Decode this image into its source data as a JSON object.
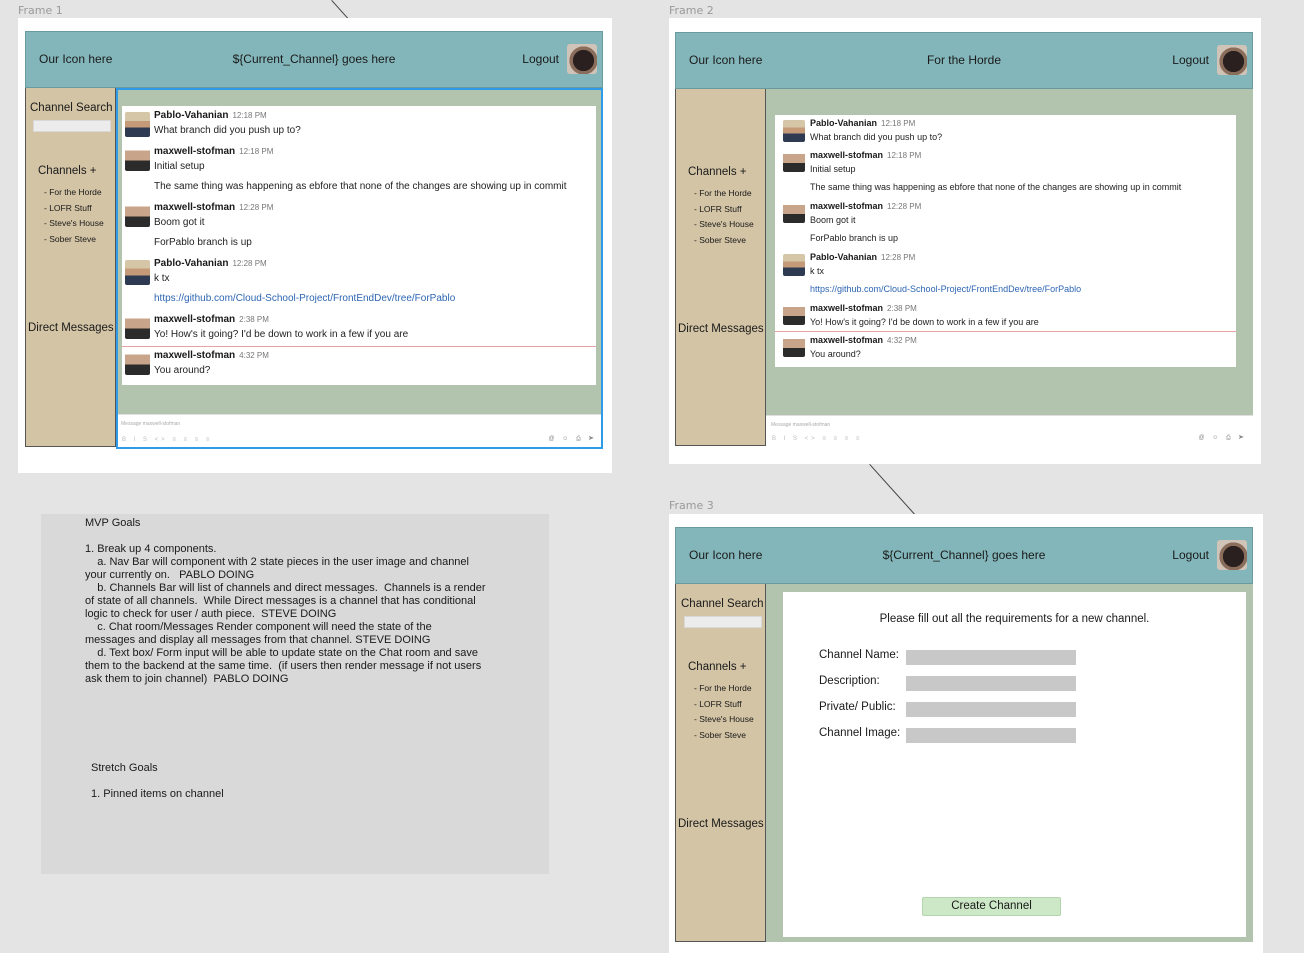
{
  "frames": {
    "frame1": "Frame 1",
    "frame2": "Frame 2",
    "frame3": "Frame 3"
  },
  "header": {
    "icon_text": "Our Icon here",
    "channel_placeholder": "${Current_Channel} goes here",
    "channel_active": "For the Horde",
    "logout": "Logout"
  },
  "sidebar": {
    "channel_search": "Channel Search",
    "channels_label": "Channels +",
    "channels": [
      "- For the Horde",
      "- LOFR Stuff",
      "- Steve's House",
      "- Sober Steve"
    ],
    "direct_messages": "Direct Messages"
  },
  "messages": [
    {
      "user": "Pablo-Vahanian",
      "time": "12:18 PM",
      "text": "What branch did you push up to?",
      "avatar": "pablo"
    },
    {
      "user": "maxwell-stofman",
      "time": "12:18 PM",
      "text": "Initial setup",
      "avatar": "max"
    },
    {
      "text": "The same thing was happening as ebfore that none of the changes are showing up in commit"
    },
    {
      "user": "maxwell-stofman",
      "time": "12:28 PM",
      "text": "Boom got it",
      "avatar": "max"
    },
    {
      "text": "ForPablo branch is up"
    },
    {
      "user": "Pablo-Vahanian",
      "time": "12:28 PM",
      "text": "k tx",
      "avatar": "pablo"
    },
    {
      "text": "https://github.com/Cloud-School-Project/FrontEndDev/tree/ForPablo",
      "link": true
    },
    {
      "user": "maxwell-stofman",
      "time": "2:38 PM",
      "text": "Yo! How's it going? I'd be down to work in a few if you are",
      "avatar": "max"
    },
    {
      "user": "maxwell-stofman",
      "time": "4:32 PM",
      "text": "You around?",
      "avatar": "max"
    }
  ],
  "composer": {
    "placeholder": "Message maxwell-stofman"
  },
  "notes": {
    "mvp_title": "MVP Goals",
    "mvp_lines": [
      "1. Break up 4 components.",
      "    a. Nav Bar will component with 2 state pieces in the user image and channel",
      "your currently on.   PABLO DOING",
      "    b. Channels Bar will list of channels and direct messages.  Channels is a render",
      "of state of all channels.  While Direct messages is a channel that has conditional",
      "logic to check for user / auth piece.  STEVE DOING",
      "    c. Chat room/Messages Render component will need the state of the",
      "messages and display all messages from that channel. STEVE DOING",
      "    d. Text box/ Form input will be able to update state on the Chat room and save",
      "them to the backend at the same time.  (if users then render message if not users",
      "ask them to join channel)  PABLO DOING"
    ],
    "stretch_title": "Stretch Goals",
    "stretch_lines": [
      "1. Pinned items on channel"
    ]
  },
  "new_channel_form": {
    "instructions": "Please fill out all the requirements for a new channel.",
    "fields": [
      "Channel Name:",
      "Description:",
      "Private/ Public:",
      "Channel Image:"
    ],
    "submit": "Create Channel"
  },
  "colors": {
    "topbar": "#83b6ba",
    "sidebar": "#d3c4a5",
    "main": "#b3c4ae",
    "selection": "#2d9be8",
    "link": "#2d66b3",
    "button": "#cde8c7"
  }
}
